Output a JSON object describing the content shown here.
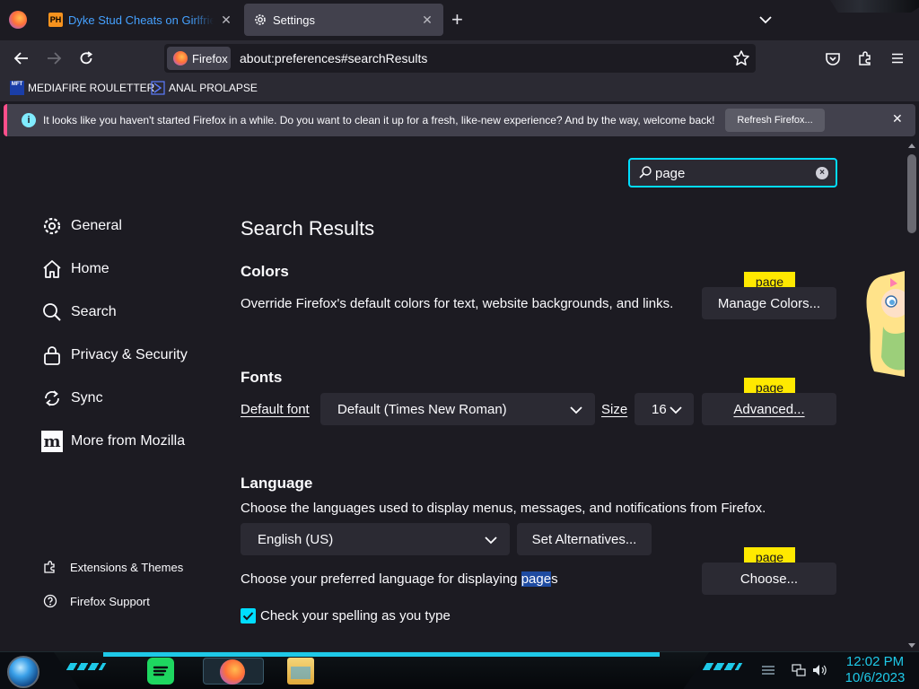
{
  "tabs": [
    {
      "title": "Dyke Stud Cheats on Girlfriend",
      "favicon": "PH"
    },
    {
      "title": "Settings"
    }
  ],
  "navbar": {
    "identity_label": "Firefox",
    "url": "about:preferences#searchResults"
  },
  "bookmarks": [
    {
      "label": "MEDIAFIRE ROULETTER",
      "icon_text": "MFT"
    },
    {
      "label": "ANAL PROLAPSE"
    }
  ],
  "notification": {
    "message": "It looks like you haven't started Firefox in a while. Do you want to clean it up for a fresh, like-new experience? And by the way, welcome back!",
    "button_label": "Refresh Firefox...",
    "accent_color": "#ff4f8b"
  },
  "search": {
    "value": "page"
  },
  "sidebar": {
    "categories": [
      {
        "label": "General",
        "icon": "gear-icon"
      },
      {
        "label": "Home",
        "icon": "home-icon"
      },
      {
        "label": "Search",
        "icon": "search-icon"
      },
      {
        "label": "Privacy & Security",
        "icon": "lock-icon"
      },
      {
        "label": "Sync",
        "icon": "sync-icon"
      },
      {
        "label": "More from Mozilla",
        "icon": "mozilla-icon"
      }
    ],
    "footer": [
      {
        "label": "Extensions & Themes",
        "icon": "puzzle-icon"
      },
      {
        "label": "Firefox Support",
        "icon": "help-icon"
      }
    ]
  },
  "main": {
    "title": "Search Results",
    "badge_text": "page",
    "colors": {
      "heading": "Colors",
      "description": "Override Firefox's default colors for text, website backgrounds, and links.",
      "button_label": "Manage Colors..."
    },
    "fonts": {
      "heading": "Fonts",
      "default_font_label": "Default font",
      "default_font_value": "Default (Times New Roman)",
      "size_label": "Size",
      "size_value": "16",
      "advanced_label": "Advanced..."
    },
    "language": {
      "heading": "Language",
      "description": "Choose the languages used to display menus, messages, and notifications from Firefox.",
      "language_value": "English (US)",
      "alternatives_label": "Set Alternatives...",
      "pref_text_before": "Choose your preferred language for displaying ",
      "pref_text_highlight": "page",
      "pref_text_after": "s",
      "choose_label": "Choose...",
      "spellcheck_label": "Check your spelling as you type",
      "spellcheck_checked": true
    }
  },
  "taskbar": {
    "time": "12:02 PM",
    "date": "10/6/2023",
    "accent_color": "#1ec9e8"
  },
  "colors": {
    "background": "#1c1b22",
    "toolbar": "#2b2a33",
    "focus": "#00ddff",
    "highlight": "#ffe900"
  }
}
